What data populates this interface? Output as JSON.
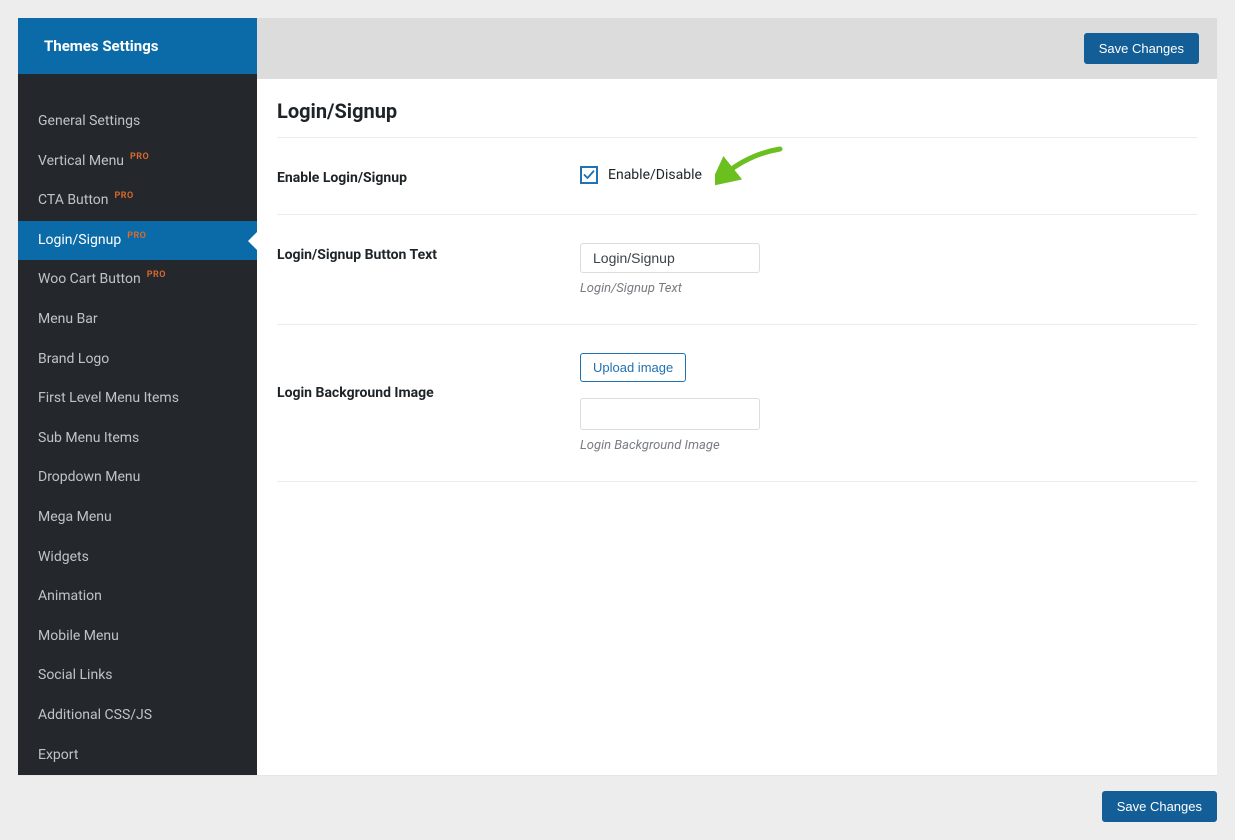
{
  "sidebar": {
    "title": "Themes Settings",
    "items": [
      {
        "label": "General Settings",
        "pro": false
      },
      {
        "label": "Vertical Menu",
        "pro": true
      },
      {
        "label": "CTA Button",
        "pro": true
      },
      {
        "label": "Login/Signup",
        "pro": true
      },
      {
        "label": "Woo Cart Button",
        "pro": true
      },
      {
        "label": "Menu Bar",
        "pro": false
      },
      {
        "label": "Brand Logo",
        "pro": false
      },
      {
        "label": "First Level Menu Items",
        "pro": false
      },
      {
        "label": "Sub Menu Items",
        "pro": false
      },
      {
        "label": "Dropdown Menu",
        "pro": false
      },
      {
        "label": "Mega Menu",
        "pro": false
      },
      {
        "label": "Widgets",
        "pro": false
      },
      {
        "label": "Animation",
        "pro": false
      },
      {
        "label": "Mobile Menu",
        "pro": false
      },
      {
        "label": "Social Links",
        "pro": false
      },
      {
        "label": "Additional CSS/JS",
        "pro": false
      },
      {
        "label": "Export",
        "pro": false
      }
    ],
    "pro_label": "PRO",
    "active_index": 3
  },
  "topbar": {
    "save_label": "Save Changes"
  },
  "page": {
    "title": "Login/Signup",
    "enable_row": {
      "label": "Enable Login/Signup",
      "checkbox_label": "Enable/Disable",
      "checked": true
    },
    "button_text_row": {
      "label": "Login/Signup Button Text",
      "value": "Login/Signup",
      "help": "Login/Signup Text"
    },
    "bg_image_row": {
      "label": "Login Background Image",
      "upload_label": "Upload image",
      "help": "Login Background Image"
    }
  },
  "bottom": {
    "save_label": "Save Changes"
  }
}
